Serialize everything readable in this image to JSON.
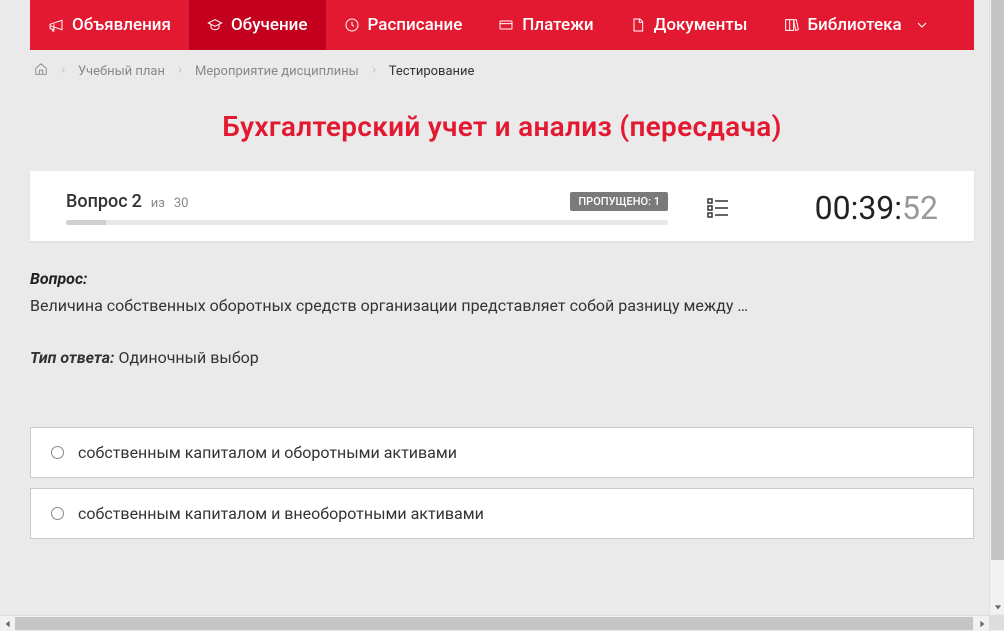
{
  "nav": {
    "items": [
      {
        "label": "Объявления",
        "icon": "megaphone"
      },
      {
        "label": "Обучение",
        "icon": "education",
        "active": true
      },
      {
        "label": "Расписание",
        "icon": "clock"
      },
      {
        "label": "Платежи",
        "icon": "card"
      },
      {
        "label": "Документы",
        "icon": "document"
      },
      {
        "label": "Библиотека",
        "icon": "library",
        "dropdown": true
      }
    ]
  },
  "breadcrumb": {
    "items": [
      {
        "label": "Учебный план"
      },
      {
        "label": "Мероприятие дисциплины"
      },
      {
        "label": "Тестирование",
        "current": true
      }
    ]
  },
  "title": "Бухгалтерский учет и анализ (пересдача)",
  "progress": {
    "question_prefix": "Вопрос",
    "question_number": "2",
    "of_word": "из",
    "total": "30",
    "skipped_label": "ПРОПУЩЕНО:",
    "skipped_count": "1"
  },
  "timer": {
    "main": "00:39:",
    "seconds": "52"
  },
  "question": {
    "label": "Вопрос:",
    "text": "Величина собственных оборотных средств организации представляет собой разницу между …"
  },
  "answer_type": {
    "label": "Тип ответа:",
    "value": "Одиночный выбор"
  },
  "options": [
    {
      "text": "собственным капиталом и оборотными активами"
    },
    {
      "text": "собственным капиталом и внеоборотными активами"
    }
  ]
}
